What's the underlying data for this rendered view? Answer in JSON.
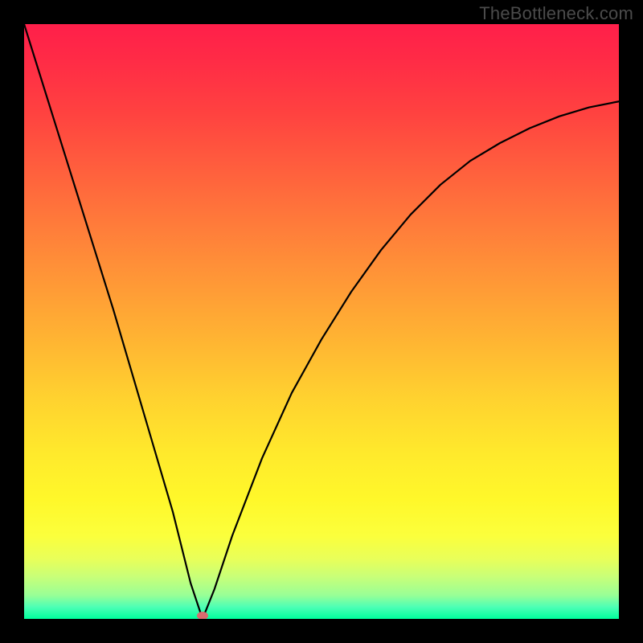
{
  "watermark": "TheBottleneck.com",
  "chart_data": {
    "type": "line",
    "title": "",
    "xlabel": "",
    "ylabel": "",
    "xlim": [
      0,
      100
    ],
    "ylim": [
      0,
      100
    ],
    "grid": false,
    "legend": false,
    "series": [
      {
        "name": "curve",
        "x": [
          0,
          5,
          10,
          15,
          20,
          25,
          28,
          30,
          32,
          35,
          40,
          45,
          50,
          55,
          60,
          65,
          70,
          75,
          80,
          85,
          90,
          95,
          100
        ],
        "values": [
          100,
          84,
          68,
          52,
          35,
          18,
          6,
          0,
          5,
          14,
          27,
          38,
          47,
          55,
          62,
          68,
          73,
          77,
          80,
          82.5,
          84.5,
          86,
          87
        ]
      }
    ],
    "marker": {
      "x": 30,
      "y": 0.5
    },
    "background_gradient": {
      "top": "#ff1f4a",
      "mid": "#ffd22f",
      "bottom": "#00ff9c"
    }
  }
}
